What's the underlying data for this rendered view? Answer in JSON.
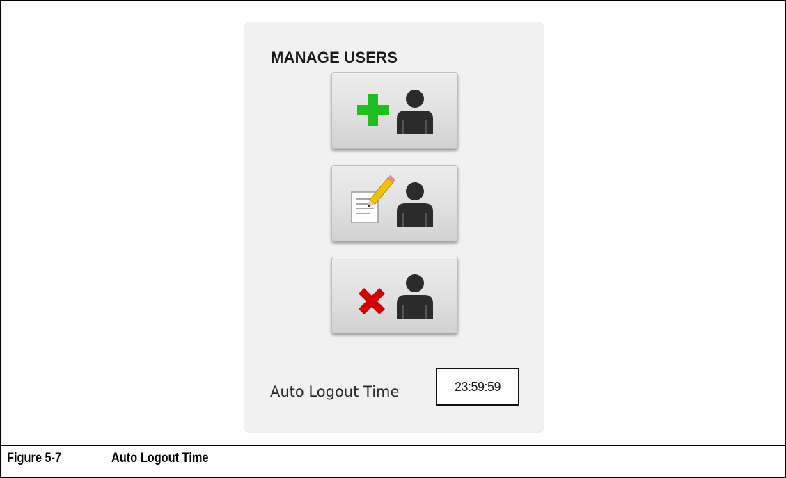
{
  "panel": {
    "title": "MANAGE USERS",
    "buttons": [
      {
        "action": "add-user",
        "icon": "plus-user-icon",
        "accent": "#1fbf1f"
      },
      {
        "action": "edit-user",
        "icon": "edit-user-icon",
        "accent": "#f2c200"
      },
      {
        "action": "delete-user",
        "icon": "delete-user-icon",
        "accent": "#d40000"
      }
    ],
    "auto_logout": {
      "label": "Auto Logout Time",
      "value": "23:59:59"
    }
  },
  "caption": {
    "number": "Figure 5-7",
    "title": "Auto Logout Time"
  },
  "colors": {
    "panel_bg": "#f1f1f1",
    "user_silhouette": "#2b2b2b",
    "add_accent": "#1fbf1f",
    "delete_accent": "#d40000"
  }
}
